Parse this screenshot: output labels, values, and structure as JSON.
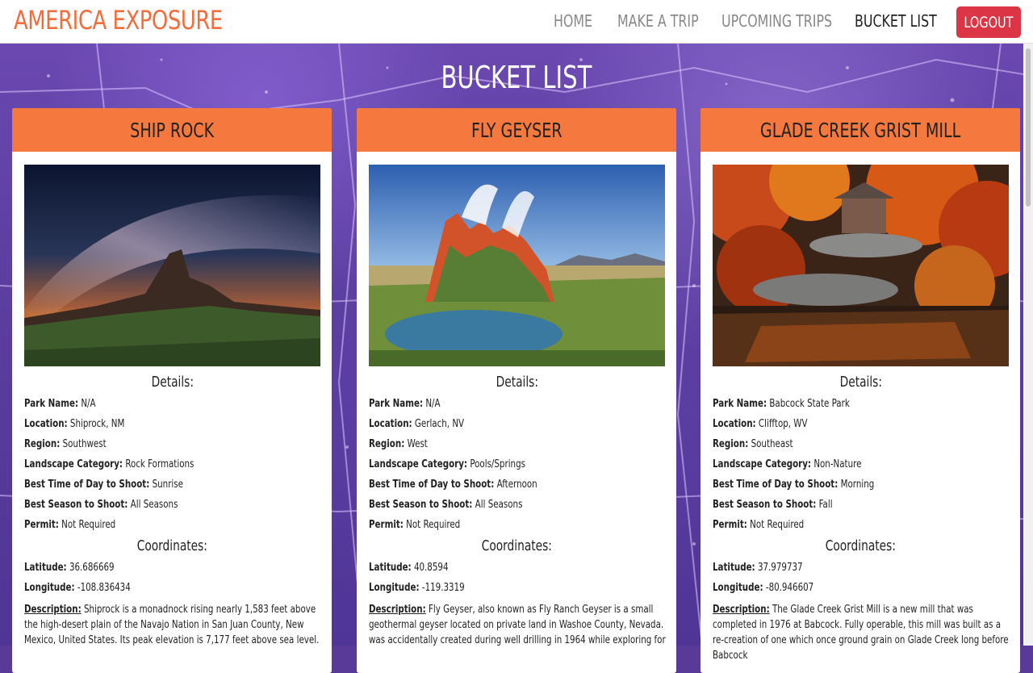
{
  "brand": "AMERICA EXPOSURE",
  "nav": {
    "home": "HOME",
    "make_trip": "MAKE A TRIP",
    "upcoming": "UPCOMING TRIPS",
    "bucket": "BUCKET LIST",
    "logout": "LOGOUT"
  },
  "page_title": "BUCKET LIST",
  "labels": {
    "details": "Details:",
    "coordinates": "Coordinates:",
    "park_name": "Park Name:",
    "location": "Location:",
    "region": "Region:",
    "landscape": "Landscape Category:",
    "time_of_day": "Best Time of Day to Shoot:",
    "season": "Best Season to Shoot:",
    "permit": "Permit:",
    "latitude": "Latitude:",
    "longitude": "Longitude:",
    "description": "Description:"
  },
  "cards": [
    {
      "title": "SHIP ROCK",
      "park_name": "N/A",
      "location": "Shiprock, NM",
      "region": "Southwest",
      "landscape": "Rock Formations",
      "time_of_day": "Sunrise",
      "season": "All Seasons",
      "permit": "Not Required",
      "latitude": "36.686669",
      "longitude": "-108.836434",
      "description": "Shiprock is a monadnock rising nearly 1,583 feet above the high-desert plain of the Navajo Nation in San Juan County, New Mexico, United States. Its peak elevation is 7,177 feet above sea level."
    },
    {
      "title": "FLY GEYSER",
      "park_name": "N/A",
      "location": "Gerlach, NV",
      "region": "West",
      "landscape": "Pools/Springs",
      "time_of_day": "Afternoon",
      "season": "All Seasons",
      "permit": "Not Required",
      "latitude": "40.8594",
      "longitude": "-119.3319",
      "description": "Fly Geyser, also known as Fly Ranch Geyser is a small geothermal geyser located on private land in Washoe County, Nevada. was accidentally created during well drilling in 1964 while exploring for"
    },
    {
      "title": "GLADE CREEK GRIST MILL",
      "park_name": "Babcock State Park",
      "location": "Clifftop, WV",
      "region": "Southeast",
      "landscape": "Non-Nature",
      "time_of_day": "Morning",
      "season": "Fall",
      "permit": "Not Required",
      "latitude": "37.979737",
      "longitude": "-80.946607",
      "description": "The Glade Creek Grist Mill is a new mill that was completed in 1976 at Babcock. Fully operable, this mill was built as a re-creation of one which once ground grain on Glade Creek long before Babcock"
    }
  ],
  "colors": {
    "brand": "#f26d3d",
    "card_header": "#f5793f",
    "logout": "#dc3545",
    "background": "#5a3a99"
  }
}
